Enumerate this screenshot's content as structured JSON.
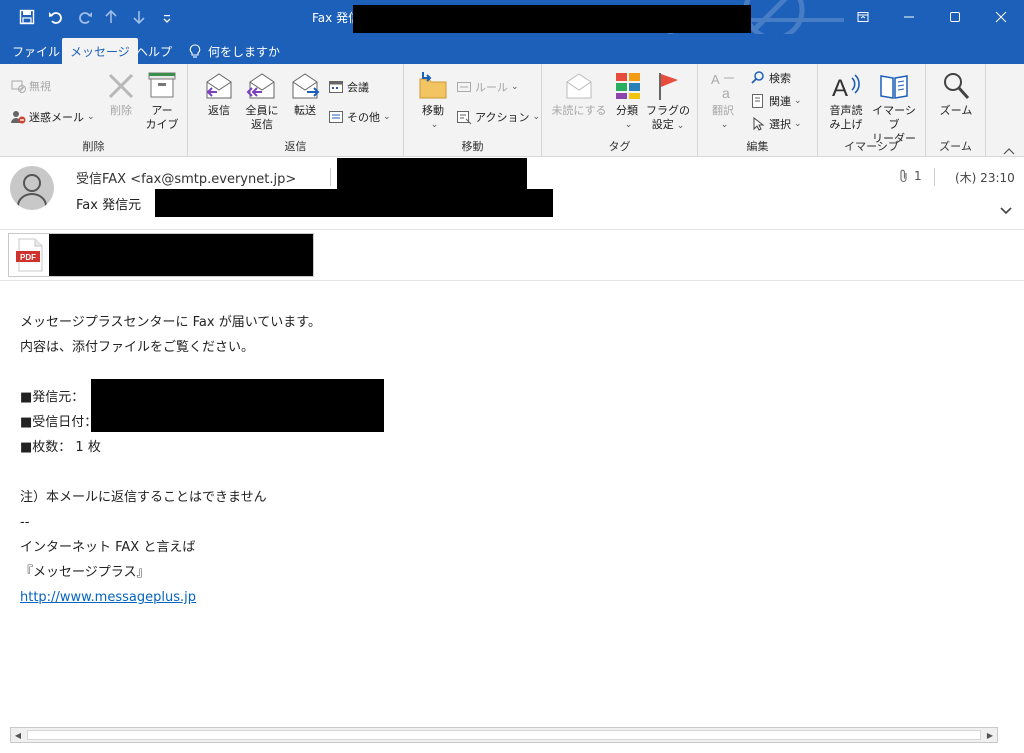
{
  "window": {
    "title": "Fax  発信元：",
    "colors": {
      "titlebar": "#1d60b9",
      "ribbon": "#f3f3f3",
      "link": "#0563c1"
    }
  },
  "quick_access": [
    {
      "icon": "save-icon"
    },
    {
      "icon": "undo-icon"
    },
    {
      "icon": "redo-icon"
    },
    {
      "icon": "up-arrow-icon"
    },
    {
      "icon": "down-arrow-icon"
    },
    {
      "icon": "customize-icon"
    }
  ],
  "tabs": [
    {
      "label": "ファイル"
    },
    {
      "label": "メッセージ",
      "active": true
    },
    {
      "label": "ヘルプ"
    },
    {
      "label": "何をしますか"
    }
  ],
  "ribbon": {
    "delete_group": {
      "label": "削除",
      "ignore": "無視",
      "junk": "迷惑メール",
      "delete": "削除",
      "archive_l1": "アー",
      "archive_l2": "カイブ"
    },
    "reply_group": {
      "label": "返信",
      "reply": "返信",
      "reply_all_l1": "全員に",
      "reply_all_l2": "返信",
      "forward": "転送",
      "meeting": "会議",
      "more": "その他"
    },
    "move_group": {
      "label": "移動",
      "move": "移動",
      "rules": "ルール",
      "actions": "アクション"
    },
    "tags_group": {
      "label": "タグ",
      "unread": "未読にする",
      "categorize": "分類",
      "flag_l1": "フラグの",
      "flag_l2": "設定"
    },
    "edit_group": {
      "label": "編集",
      "translate": "翻訳",
      "find": "検索",
      "related": "関連",
      "select": "選択"
    },
    "immersive_group": {
      "label": "イマーシブ",
      "read_aloud_l1": "音声読",
      "read_aloud_l2": "み上げ",
      "reader_l1": "イマーシブ",
      "reader_l2": "リーダー"
    },
    "zoom_group": {
      "label": "ズーム",
      "zoom": "ズーム"
    }
  },
  "message": {
    "sender": "受信FAX  <fax@smtp.everynet.jp>",
    "subject": "Fax  発信元",
    "attachment_count": "1",
    "datetime": "(木) 23:10",
    "attachment_type": "PDF",
    "body": {
      "line1": "メッセージプラスセンターに Fax が届いています。",
      "line2": "内容は、添付ファイルをご覧ください。",
      "from_label": "■発信元：",
      "date_label": "■受信日付：",
      "pages": "■枚数：  1 枚",
      "note": "注）本メールに返信することはできません",
      "dash": "--",
      "promo1": "インターネット FAX と言えば",
      "promo2": "『メッセージプラス』",
      "link": "http://www.messageplus.jp"
    }
  }
}
